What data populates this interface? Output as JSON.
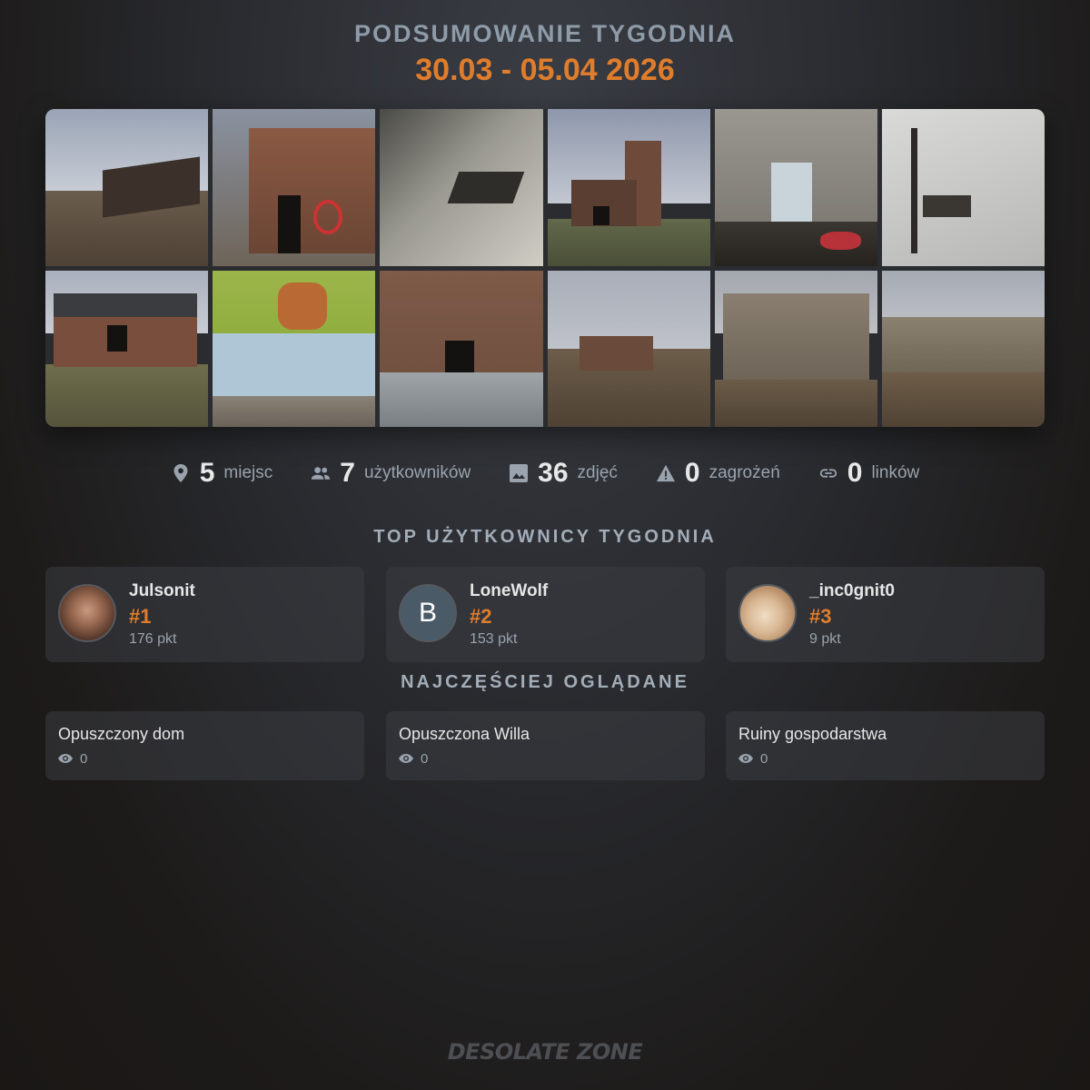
{
  "header": {
    "title": "PODSUMOWANIE TYGODNIA",
    "date_range": "30.03 - 05.04 2026"
  },
  "colors": {
    "accent": "#e07d2c",
    "muted": "#9aa3ad",
    "title": "#8e9ba8"
  },
  "gallery": {
    "photo_count": 12
  },
  "stats": [
    {
      "icon": "location-pin-icon",
      "value": "5",
      "label": "miejsc"
    },
    {
      "icon": "users-icon",
      "value": "7",
      "label": "użytkowników"
    },
    {
      "icon": "image-icon",
      "value": "36",
      "label": "zdjęć"
    },
    {
      "icon": "warning-icon",
      "value": "0",
      "label": "zagrożeń"
    },
    {
      "icon": "link-icon",
      "value": "0",
      "label": "linków"
    }
  ],
  "top_users": {
    "heading": "TOP UŻYTKOWNICY TYGODNIA",
    "items": [
      {
        "name": "Julsonit",
        "rank": "#1",
        "points": "176 pkt",
        "avatar": "photo"
      },
      {
        "name": "LoneWolf",
        "rank": "#2",
        "points": "153 pkt",
        "avatar_letter": "B"
      },
      {
        "name": "_inc0gnit0",
        "rank": "#3",
        "points": "9 pkt",
        "avatar": "photo"
      }
    ]
  },
  "most_viewed": {
    "heading": "NAJCZĘŚCIEJ OGLĄDANE",
    "items": [
      {
        "name": "Opuszczony dom",
        "views": "0"
      },
      {
        "name": "Opuszczona Willa",
        "views": "0"
      },
      {
        "name": "Ruiny gospodarstwa",
        "views": "0"
      }
    ]
  },
  "footer": {
    "logo_text": "DESOLATE ZONE"
  }
}
